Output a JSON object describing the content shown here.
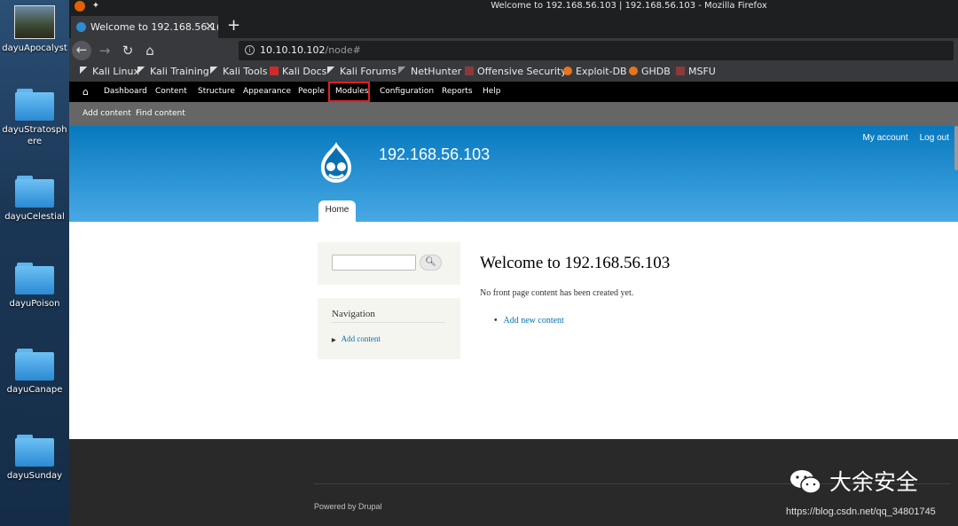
{
  "desktop": {
    "icons": [
      {
        "label": "dayuApocalyst"
      },
      {
        "label": "dayuStratosphere"
      },
      {
        "label": "dayuCelestial"
      },
      {
        "label": "dayuPoison"
      },
      {
        "label": "dayuCanape"
      },
      {
        "label": "dayuSunday"
      }
    ]
  },
  "window": {
    "title": "Welcome to 192.168.56.103 | 192.168.56.103 - Mozilla Firefox"
  },
  "browser": {
    "tab_title": "Welcome to 192.168.56.1(",
    "new_tab": "+",
    "url_host": "10.10.10.102",
    "url_path": "/node#",
    "bookmarks": [
      "Kali Linux",
      "Kali Training",
      "Kali Tools",
      "Kali Docs",
      "Kali Forums",
      "NetHunter",
      "Offensive Security",
      "Exploit-DB",
      "GHDB",
      "MSFU"
    ]
  },
  "admin": {
    "menu": [
      "Dashboard",
      "Content",
      "Structure",
      "Appearance",
      "People",
      "Modules",
      "Configuration",
      "Reports",
      "Help"
    ],
    "shortcuts": [
      "Add content",
      "Find content"
    ],
    "highlighted": "Modules"
  },
  "site": {
    "name": "192.168.56.103",
    "secondary_menu": [
      "My account",
      "Log out"
    ],
    "home_tab": "Home"
  },
  "sidebar": {
    "search_button_icon": "search-icon",
    "nav_title": "Navigation",
    "nav_link": "Add content"
  },
  "content": {
    "title": "Welcome to 192.168.56.103",
    "message": "No front page content has been created yet.",
    "link": "Add new content"
  },
  "footer": {
    "powered": "Powered by Drupal"
  },
  "watermark": {
    "name": "大余安全",
    "url": "https://blog.csdn.net/qq_34801745"
  },
  "colors": {
    "accent": "#0779bf",
    "highlight_box": "#e02020",
    "link": "#0071b3"
  }
}
